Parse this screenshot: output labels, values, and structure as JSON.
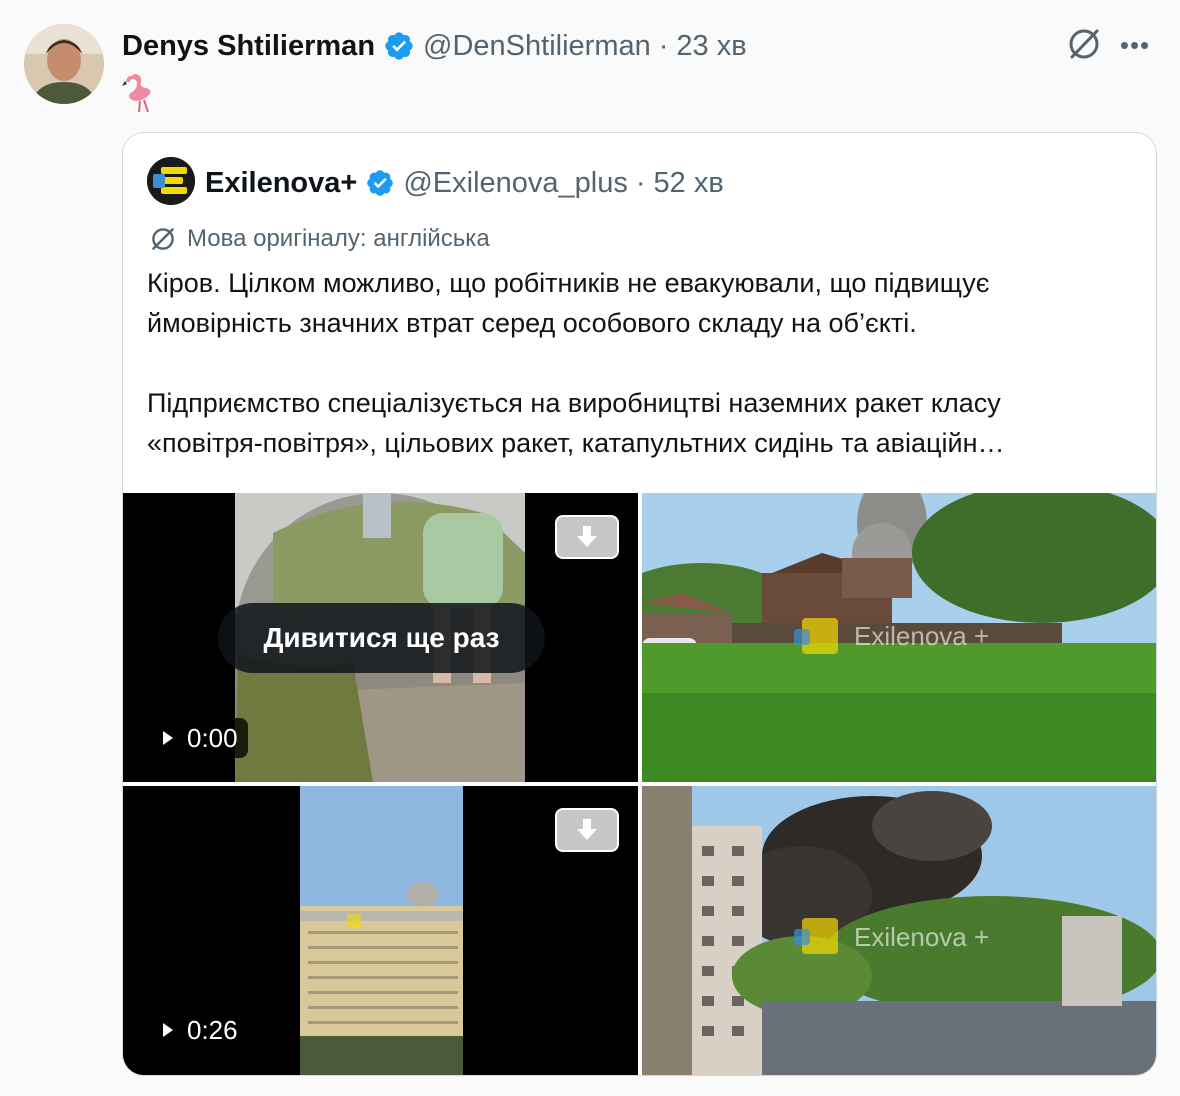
{
  "post": {
    "author_name": "Denys Shtilierman",
    "handle": "@DenShtilierman",
    "separator": "·",
    "time": "23 хв",
    "verified": true,
    "emoji_icon": "flamingo-icon",
    "more_label": "•••"
  },
  "quoted": {
    "author_name": "Exilenova+",
    "handle": "@Exilenova_plus",
    "separator": "·",
    "time": "52 хв",
    "verified": true,
    "translation_note": "Мова оригіналу: англійська",
    "text_lines": [
      "Кіров. Цілком можливо, що робітників не евакуювали, що підвищує",
      "ймовірність значних втрат серед особового складу на об’єкті.",
      "Підприємство спеціалізується на виробництві наземних ракет класу",
      "«повітря-повітря», цільових ракет, катапультних сидінь та авіаційн…"
    ]
  },
  "media": {
    "video1": {
      "replay_label": "Дивитися ще раз",
      "duration": "0:00"
    },
    "photo1": {
      "watermark": "Exilenova +"
    },
    "video2": {
      "duration": "0:26"
    },
    "photo2": {
      "watermark": "Exilenova +"
    }
  },
  "colors": {
    "verified": "#1d9bf0",
    "text": "#0f1419",
    "muted": "#536471",
    "border": "#cfd9de",
    "brand_yellow": "#f5d800"
  }
}
